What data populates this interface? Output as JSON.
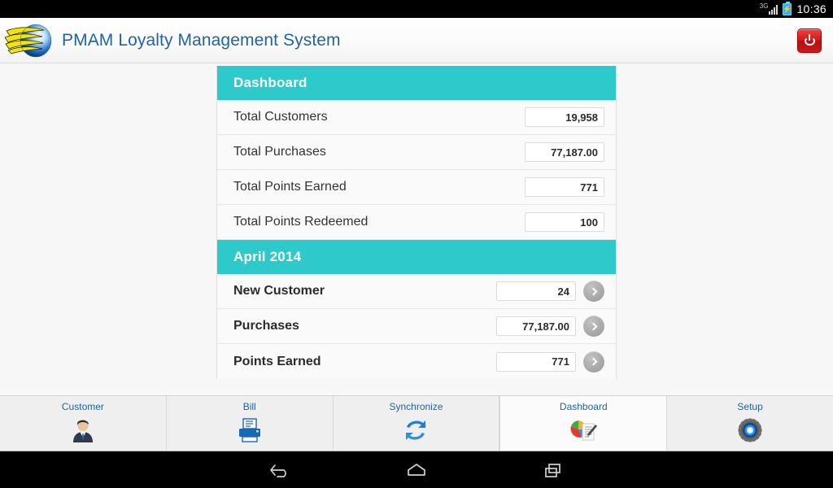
{
  "statusbar": {
    "network_label": "3G",
    "signal_icon": "signal-bars-icon",
    "battery_icon": "battery-charging-icon",
    "time": "10:36"
  },
  "header": {
    "logo_icon": "pmam-globe-logo-icon",
    "title": "PMAM Loyalty Management System",
    "power_icon": "power-button-icon"
  },
  "panel": {
    "sections": [
      {
        "title": "Dashboard",
        "rows": [
          {
            "label": "Total Customers",
            "value": "19,958",
            "has_arrow": false,
            "bold": false
          },
          {
            "label": "Total Purchases",
            "value": "77,187.00",
            "has_arrow": false,
            "bold": false
          },
          {
            "label": "Total Points Earned",
            "value": "771",
            "has_arrow": false,
            "bold": false
          },
          {
            "label": "Total Points Redeemed",
            "value": "100",
            "has_arrow": false,
            "bold": false
          }
        ]
      },
      {
        "title": "April 2014",
        "rows": [
          {
            "label": "New Customer",
            "value": "24",
            "has_arrow": true,
            "bold": true
          },
          {
            "label": "Purchases",
            "value": "77,187.00",
            "has_arrow": true,
            "bold": true
          },
          {
            "label": "Points Earned",
            "value": "771",
            "has_arrow": true,
            "bold": true
          }
        ]
      }
    ]
  },
  "tabbar": {
    "items": [
      {
        "label": "Customer",
        "icon": "businessman-avatar-icon",
        "selected": false
      },
      {
        "label": "Bill",
        "icon": "printer-icon",
        "selected": false
      },
      {
        "label": "Synchronize",
        "icon": "sync-arrows-icon",
        "selected": false
      },
      {
        "label": "Dashboard",
        "icon": "pie-chart-report-icon",
        "selected": true
      },
      {
        "label": "Setup",
        "icon": "gear-icon",
        "selected": false
      }
    ]
  },
  "navbar": {
    "back": "back-arrow-icon",
    "home": "home-icon",
    "recents": "recent-apps-icon"
  },
  "colors": {
    "accent_teal": "#2ecacb",
    "link_blue": "#1f63a8",
    "power_red": "#d21a1a",
    "tab_bg": "#efefef"
  }
}
